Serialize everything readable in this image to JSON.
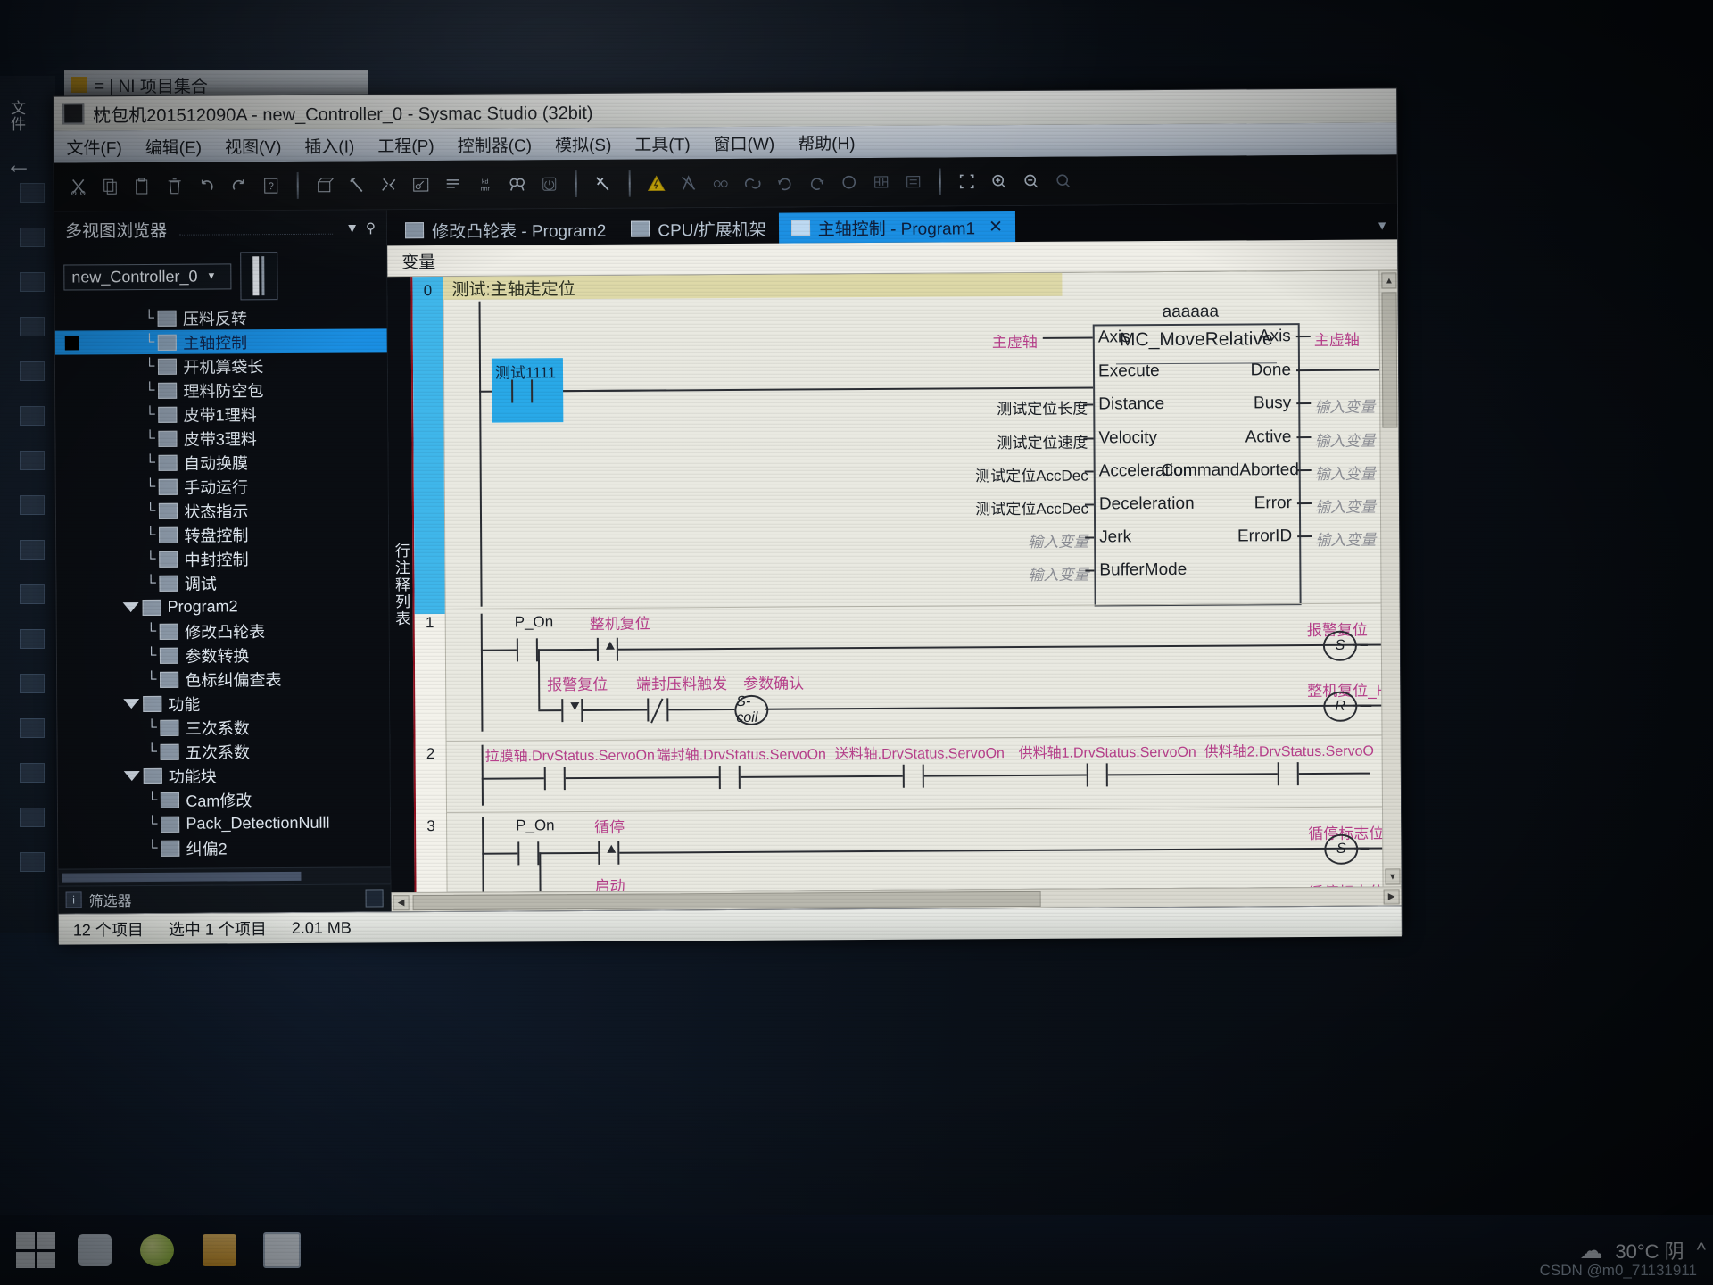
{
  "background": {
    "side_label": "文件",
    "ni_window_title": "= | NI 项目集合",
    "back_arrow": "←"
  },
  "window": {
    "title": "枕包机201512090A - new_Controller_0 - Sysmac Studio (32bit)",
    "app_icon": "sysmac-app-icon"
  },
  "menubar": {
    "items": [
      {
        "label": "文件(F)",
        "name": "menu-file"
      },
      {
        "label": "编辑(E)",
        "name": "menu-edit"
      },
      {
        "label": "视图(V)",
        "name": "menu-view"
      },
      {
        "label": "插入(I)",
        "name": "menu-insert"
      },
      {
        "label": "工程(P)",
        "name": "menu-project"
      },
      {
        "label": "控制器(C)",
        "name": "menu-controller"
      },
      {
        "label": "模拟(S)",
        "name": "menu-simulation"
      },
      {
        "label": "工具(T)",
        "name": "menu-tools"
      },
      {
        "label": "窗口(W)",
        "name": "menu-window"
      },
      {
        "label": "帮助(H)",
        "name": "menu-help"
      }
    ]
  },
  "toolbar": {
    "groups": [
      [
        "cut-icon",
        "copy-icon",
        "paste-icon",
        "delete-icon",
        "undo-icon",
        "redo-icon",
        "insert-help-icon"
      ],
      [
        "build-icon",
        "hammer-icon",
        "rebuild-icon",
        "compare-icon",
        "list-icon",
        "memory-icon",
        "search-icon",
        "simulation-icon"
      ],
      [
        "online-icon"
      ],
      [
        "warning-icon",
        "transfer-to-controller-icon",
        "transfer-from-controller-icon",
        "compare-online-icon",
        "sync-icon",
        "sync-back-icon",
        "monitor-icon",
        "ladder-monitor-icon",
        "cross-reference-icon"
      ],
      [
        "fit-icon",
        "zoom-in-icon",
        "zoom-out-icon",
        "zoom-reset-icon"
      ]
    ]
  },
  "explorer": {
    "title": "多视图浏览器",
    "collapse_icon": "chevron-down-icon",
    "pin_icon": "pin-icon",
    "controller_combo": {
      "value": "new_Controller_0",
      "arrow": "chevron-down-icon"
    },
    "tree": [
      {
        "label": "压料反转",
        "indent": 3,
        "icon": "program-section-icon",
        "branch": "└",
        "selected": false
      },
      {
        "label": "主轴控制",
        "indent": 3,
        "icon": "program-section-icon",
        "branch": "└",
        "selected": true
      },
      {
        "label": "开机算袋长",
        "indent": 3,
        "icon": "program-section-icon",
        "branch": "└",
        "selected": false
      },
      {
        "label": "理料防空包",
        "indent": 3,
        "icon": "program-section-icon",
        "branch": "└",
        "selected": false
      },
      {
        "label": "皮带1理料",
        "indent": 3,
        "icon": "program-section-icon",
        "branch": "└",
        "selected": false
      },
      {
        "label": "皮带3理料",
        "indent": 3,
        "icon": "program-section-icon",
        "branch": "└",
        "selected": false
      },
      {
        "label": "自动换膜",
        "indent": 3,
        "icon": "program-section-icon",
        "branch": "└",
        "selected": false
      },
      {
        "label": "手动运行",
        "indent": 3,
        "icon": "program-section-icon",
        "branch": "└",
        "selected": false
      },
      {
        "label": "状态指示",
        "indent": 3,
        "icon": "program-section-icon",
        "branch": "└",
        "selected": false
      },
      {
        "label": "转盘控制",
        "indent": 3,
        "icon": "program-section-icon",
        "branch": "└",
        "selected": false
      },
      {
        "label": "中封控制",
        "indent": 3,
        "icon": "program-section-icon",
        "branch": "└",
        "selected": false
      },
      {
        "label": "调试",
        "indent": 3,
        "icon": "program-section-icon",
        "branch": "└",
        "selected": false
      },
      {
        "label": "Program2",
        "indent": 2,
        "icon": "program-icon",
        "branch": "▼",
        "selected": false
      },
      {
        "label": "修改凸轮表",
        "indent": 3,
        "icon": "program-section-icon",
        "branch": "└",
        "selected": false
      },
      {
        "label": "参数转换",
        "indent": 3,
        "icon": "program-section-icon",
        "branch": "└",
        "selected": false
      },
      {
        "label": "色标纠偏查表",
        "indent": 3,
        "icon": "program-section-icon",
        "branch": "└",
        "selected": false
      },
      {
        "label": "功能",
        "indent": 2,
        "icon": "function-folder-icon",
        "branch": "▼",
        "selected": false
      },
      {
        "label": "三次系数",
        "indent": 3,
        "icon": "function-icon",
        "branch": "└",
        "selected": false
      },
      {
        "label": "五次系数",
        "indent": 3,
        "icon": "function-icon",
        "branch": "└",
        "selected": false
      },
      {
        "label": "功能块",
        "indent": 2,
        "icon": "fb-folder-icon",
        "branch": "▼",
        "selected": false
      },
      {
        "label": "Cam修改",
        "indent": 3,
        "icon": "fb-icon",
        "branch": "└",
        "selected": false
      },
      {
        "label": "Pack_DetectionNulll",
        "indent": 3,
        "icon": "fb-icon",
        "branch": "└",
        "selected": false
      },
      {
        "label": "纠偏2",
        "indent": 3,
        "icon": "fb-icon",
        "branch": "└",
        "selected": false
      }
    ],
    "filter_label": "筛选器",
    "filter_icon": "info-icon"
  },
  "tabs": [
    {
      "label": "修改凸轮表 - Program2",
      "icon": "section-icon",
      "active": false,
      "closable": false
    },
    {
      "label": "CPU/扩展机架",
      "icon": "rack-icon",
      "active": false,
      "closable": false
    },
    {
      "label": "主轴控制 - Program1",
      "icon": "section-icon",
      "active": true,
      "closable": true,
      "close_icon": "close-icon"
    }
  ],
  "variable_bar": {
    "label": "变量"
  },
  "gutter": {
    "label": "行注释列表"
  },
  "ladder": {
    "rungs": [
      {
        "number": "0",
        "highlighted": true,
        "comment": "测试:主轴走定位",
        "contacts": [
          {
            "label": "测试1111",
            "type": "no",
            "selected": true
          }
        ],
        "block": {
          "instance_name": "aaaaaa",
          "type_name": "MC_MoveRelative",
          "inputs": [
            {
              "pin": "Axis",
              "value": "主虚轴",
              "style": "pink"
            },
            {
              "pin": "Execute",
              "value": "",
              "style": "wire"
            },
            {
              "pin": "Distance",
              "value": "测试定位长度",
              "style": "dark"
            },
            {
              "pin": "Velocity",
              "value": "测试定位速度",
              "style": "dark"
            },
            {
              "pin": "Acceleration",
              "value": "测试定位AccDec",
              "style": "dark"
            },
            {
              "pin": "Deceleration",
              "value": "测试定位AccDec",
              "style": "dark"
            },
            {
              "pin": "Jerk",
              "value": "输入变量",
              "style": "gray"
            },
            {
              "pin": "BufferMode",
              "value": "输入变量",
              "style": "gray"
            }
          ],
          "outputs": [
            {
              "pin": "Axis",
              "value": "主虚轴",
              "style": "pink"
            },
            {
              "pin": "Done",
              "value": "",
              "style": "wire"
            },
            {
              "pin": "Busy",
              "value": "输入变量",
              "style": "gray"
            },
            {
              "pin": "Active",
              "value": "输入变量",
              "style": "gray"
            },
            {
              "pin": "CommandAborted",
              "value": "输入变量",
              "style": "gray"
            },
            {
              "pin": "Error",
              "value": "输入变量",
              "style": "gray"
            },
            {
              "pin": "ErrorID",
              "value": "输入变量",
              "style": "gray"
            }
          ]
        }
      },
      {
        "number": "1",
        "highlighted": false,
        "branches": [
          {
            "contacts": [
              {
                "label": "P_On",
                "type": "no"
              },
              {
                "label": "整机复位",
                "type": "pos-edge",
                "style": "pink"
              }
            ],
            "coil": {
              "label": "报警复位",
              "type": "S",
              "style": "pink"
            }
          },
          {
            "contacts": [
              {
                "label": "报警复位",
                "type": "neg-edge",
                "style": "pink"
              },
              {
                "label": "端封压料触发",
                "type": "nc",
                "style": "pink"
              },
              {
                "label": "参数确认",
                "type": "S-coil",
                "style": "pink"
              }
            ],
            "coil": {
              "label": "整机复位_HMI",
              "type": "R",
              "style": "pink"
            }
          }
        ]
      },
      {
        "number": "2",
        "highlighted": false,
        "contacts": [
          {
            "label": "拉膜轴.DrvStatus.ServoOn",
            "type": "no",
            "style": "pink"
          },
          {
            "label": "端封轴.DrvStatus.ServoOn",
            "type": "no",
            "style": "pink"
          },
          {
            "label": "送料轴.DrvStatus.ServoOn",
            "type": "no",
            "style": "pink"
          },
          {
            "label": "供料轴1.DrvStatus.ServoOn",
            "type": "no",
            "style": "pink"
          },
          {
            "label": "供料轴2.DrvStatus.ServoO",
            "type": "no",
            "style": "pink"
          }
        ]
      },
      {
        "number": "3",
        "highlighted": false,
        "branches": [
          {
            "contacts": [
              {
                "label": "P_On",
                "type": "no"
              },
              {
                "label": "循停",
                "type": "pos-edge",
                "style": "pink"
              }
            ],
            "coil": {
              "label": "循停标志位",
              "type": "S",
              "style": "pink"
            }
          },
          {
            "contacts": [
              {
                "label": "启动",
                "type": "pos-edge",
                "style": "pink"
              }
            ],
            "coil": {
              "label": "循停标志位",
              "type": "R",
              "style": "pink"
            }
          }
        ]
      }
    ]
  },
  "statusbar": {
    "item_count": "12 个项目",
    "selection": "选中 1 个项目",
    "size": "2.01 MB"
  },
  "taskbar": {
    "start_icon": "windows-start-icon",
    "items": [
      "task-view-icon",
      "browser-icon",
      "file-explorer-icon",
      "sysmac-studio-icon"
    ],
    "weather": "30°C 阴",
    "weather_icon": "cloud-icon",
    "tray_icon": "chevron-up-icon",
    "watermark": "CSDN @m0_71131911"
  }
}
